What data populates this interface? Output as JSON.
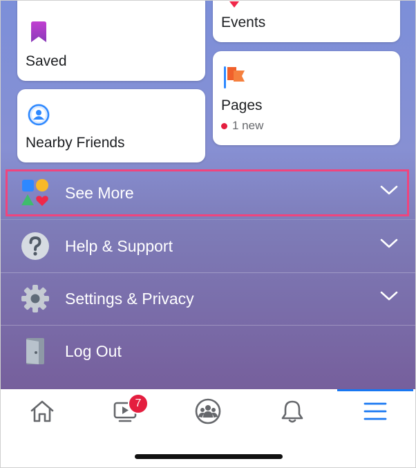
{
  "shortcuts": {
    "saved": {
      "label": "Saved",
      "icon": "bookmark-icon"
    },
    "events": {
      "label": "Events",
      "icon": "calendar-heart-icon"
    },
    "nearby_friends": {
      "label": "Nearby Friends",
      "icon": "nearby-friends-icon"
    },
    "pages": {
      "label": "Pages",
      "icon": "flag-icon",
      "sub": "1 new"
    }
  },
  "menu": [
    {
      "label": "See More",
      "icon": "shapes-icon",
      "highlighted": true
    },
    {
      "label": "Help & Support",
      "icon": "question-icon"
    },
    {
      "label": "Settings & Privacy",
      "icon": "gear-icon"
    },
    {
      "label": "Log Out",
      "icon": "door-icon"
    }
  ],
  "tabs": [
    {
      "name": "home",
      "icon": "home-icon"
    },
    {
      "name": "watch",
      "icon": "video-icon",
      "badge": "7"
    },
    {
      "name": "groups",
      "icon": "groups-icon"
    },
    {
      "name": "notifications",
      "icon": "bell-icon"
    },
    {
      "name": "menu",
      "icon": "hamburger-menu-icon",
      "active": true
    }
  ],
  "colors": {
    "accent": "#1877f2",
    "highlight_border": "#f0447d",
    "badge": "#e41e3f"
  }
}
